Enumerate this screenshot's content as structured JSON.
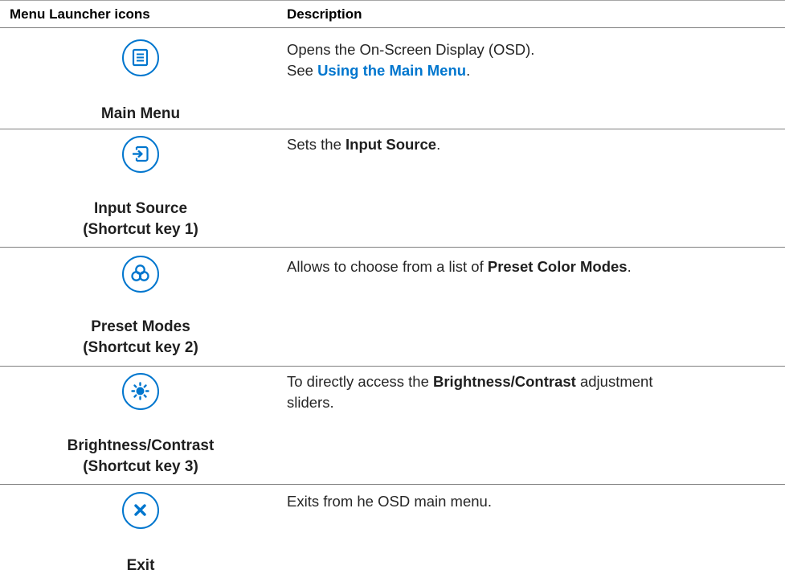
{
  "table": {
    "headers": [
      "Menu Launcher icons",
      "Description"
    ],
    "rows": [
      {
        "icon": "menu-list-icon",
        "caption_line1": "Main Menu",
        "caption_line2": "",
        "desc_line1": "Opens the On-Screen Display (OSD).",
        "desc_line2_prefix": "See ",
        "desc_line2_link": "Using the Main Menu",
        "desc_line2_suffix": "."
      },
      {
        "icon": "input-source-icon",
        "caption_line1": "Input Source",
        "caption_line2": "(Shortcut key 1)",
        "desc_prefix": "Sets the ",
        "desc_bold": "Input Source",
        "desc_suffix": "."
      },
      {
        "icon": "preset-modes-icon",
        "caption_line1": "Preset Modes",
        "caption_line2": "(Shortcut key 2)",
        "desc_prefix": "Allows to choose from a list of ",
        "desc_bold": "Preset Color Modes",
        "desc_suffix": "."
      },
      {
        "icon": "brightness-icon",
        "caption_line1": "Brightness/Contrast",
        "caption_line2": "(Shortcut key 3)",
        "desc_prefix": "To directly access the ",
        "desc_bold": "Brightness/Contrast",
        "desc_suffix": " adjustment sliders."
      },
      {
        "icon": "close-icon",
        "caption_line1": "Exit",
        "caption_line2": "",
        "desc_text": "Exits from he OSD main menu."
      }
    ]
  },
  "colors": {
    "accent": "#0076ce",
    "rule": "#7f7f7f",
    "text": "#1f1f1f"
  }
}
